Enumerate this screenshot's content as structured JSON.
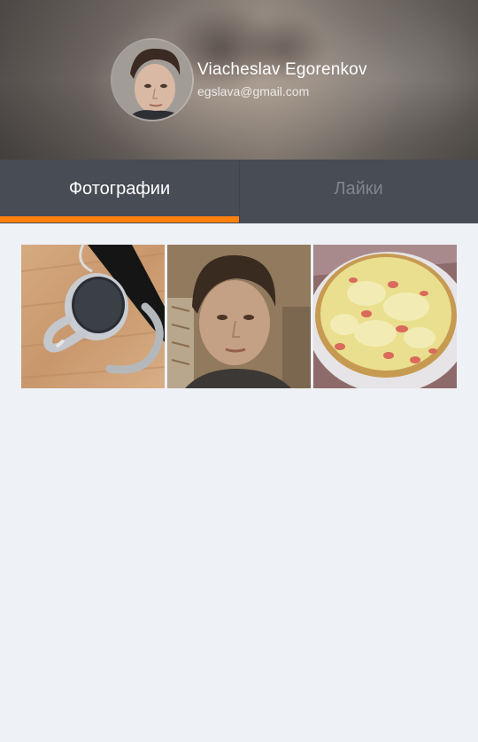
{
  "profile": {
    "name": "Viacheslav Egorenkov",
    "email": "egslava@gmail.com"
  },
  "tabs": [
    {
      "label": "Фотографии",
      "active": true
    },
    {
      "label": "Лайки",
      "active": false
    }
  ],
  "colors": {
    "accent": "#ff7f0f",
    "tabbar": "#474c55",
    "background": "#eef1f5"
  },
  "photos": [
    {
      "subject": "headphones"
    },
    {
      "subject": "selfie"
    },
    {
      "subject": "pizza"
    }
  ]
}
